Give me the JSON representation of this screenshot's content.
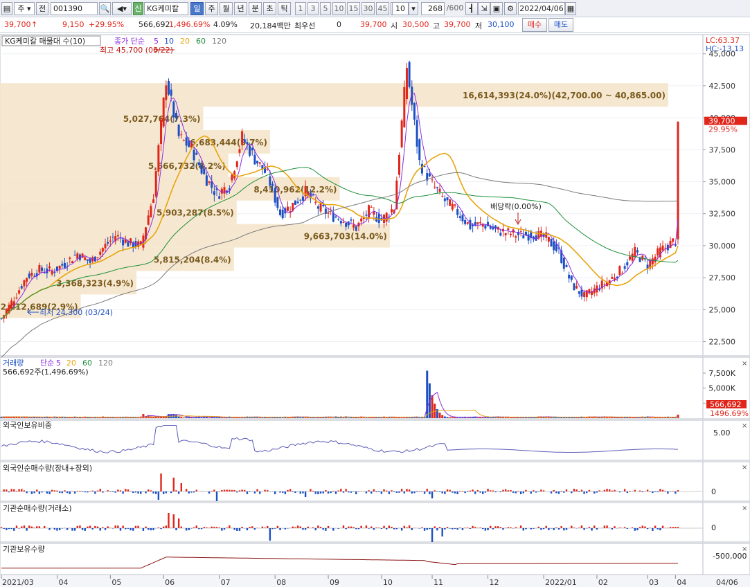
{
  "toolbar": {
    "type_select": "주",
    "prev_label": "전",
    "code": "001390",
    "market_tag": "신",
    "name": "KG케미칼",
    "periods": [
      "일",
      "주",
      "월",
      "년",
      "분",
      "초",
      "틱"
    ],
    "active_period": "일",
    "numbers": [
      "1",
      "3",
      "5",
      "10",
      "15",
      "30",
      "45",
      "60"
    ],
    "count_value": "10",
    "range": "268",
    "range_total": "/600",
    "date": "2022/04/06"
  },
  "quote": {
    "price": "39,700",
    "arrow": "↑",
    "change": "9,150",
    "change_pct": "+29.95%",
    "volume": "566,692",
    "volume_pct": "1,496.69%",
    "turnover": "4.09%",
    "amount": "20,184백만",
    "preferred_label": "최우선",
    "preferred_value": "0",
    "ask": "39,700",
    "open_label": "시",
    "open": "30,500",
    "high_label": "고",
    "high": "39,700",
    "low_label": "저",
    "low": "30,100",
    "buy_label": "매수",
    "sell_label": "매도"
  },
  "colors": {
    "up": "#e0261b",
    "down": "#1d4fc4",
    "ma5": "#8a2be2",
    "ma20": "#e8a40c",
    "ma60": "#1e8f3a",
    "ma120": "#7a7a7a",
    "profile": "#f5e4c8"
  },
  "chart_data": {
    "type": "candlestick",
    "price_panel": {
      "title": "KG케미칼 매물대 수(10)",
      "legend": {
        "label": "종가 단순",
        "periods": [
          "5",
          "10",
          "20",
          "60",
          "120"
        ]
      },
      "y_ticks": [
        "45,000",
        "42,500",
        "40,000",
        "37,500",
        "35,000",
        "32,500",
        "30,000",
        "27,500",
        "25,000",
        "22,500"
      ],
      "ylim": [
        21500,
        46500
      ],
      "lc": "LC:63.37",
      "hc": "HC:-13.13",
      "last_price_tag": "39,700",
      "last_pct_tag": "29.95%",
      "max_annotation": "최고 45,700 (06/22)",
      "min_annotation": "최저 24,300 (03/24)",
      "dividend_annotation": "배당락(0.00%)",
      "volume_profile": [
        {
          "price_from": 40865,
          "price_to": 42700,
          "label": "16,614,393(24.0%)(42,700.00 ~ 40,865.00)",
          "share": 24.0
        },
        {
          "price_from": 39030,
          "price_to": 40865,
          "label": "5,027,764(7.3%)",
          "share": 7.3
        },
        {
          "price_from": 37195,
          "price_to": 39030,
          "label": "6,683,444(9.7%)",
          "share": 9.7
        },
        {
          "price_from": 35360,
          "price_to": 37195,
          "label": "5,666,732(8.2%)",
          "share": 8.2
        },
        {
          "price_from": 33525,
          "price_to": 35360,
          "label": "8,410,962(12.2%)",
          "share": 12.2
        },
        {
          "price_from": 31690,
          "price_to": 33525,
          "label": "5,903,287(8.5%)",
          "share": 8.5
        },
        {
          "price_from": 29855,
          "price_to": 31690,
          "label": "9,663,703(14.0%)",
          "share": 14.0
        },
        {
          "price_from": 28020,
          "price_to": 29855,
          "label": "5,815,204(8.4%)",
          "share": 8.4
        },
        {
          "price_from": 26185,
          "price_to": 28020,
          "label": "3,368,323(4.9%)",
          "share": 4.9
        },
        {
          "price_from": 24350,
          "price_to": 26185,
          "label": "2,012,689(2.9%)",
          "share": 2.9
        }
      ],
      "close_series": [
        {
          "d": "03/24",
          "c": 24300
        },
        {
          "d": "04/01",
          "c": 25900
        },
        {
          "d": "04/09",
          "c": 27600
        },
        {
          "d": "04/16",
          "c": 28100
        },
        {
          "d": "04/23",
          "c": 28000
        },
        {
          "d": "04/30",
          "c": 28600
        },
        {
          "d": "05/07",
          "c": 29400
        },
        {
          "d": "05/14",
          "c": 28700
        },
        {
          "d": "05/21",
          "c": 29800
        },
        {
          "d": "05/28",
          "c": 30800
        },
        {
          "d": "06/04",
          "c": 30200
        },
        {
          "d": "06/11",
          "c": 30000
        },
        {
          "d": "06/16",
          "c": 34000
        },
        {
          "d": "06/22",
          "c": 43000
        },
        {
          "d": "06/29",
          "c": 38500
        },
        {
          "d": "07/06",
          "c": 37600
        },
        {
          "d": "07/13",
          "c": 35500
        },
        {
          "d": "07/20",
          "c": 34000
        },
        {
          "d": "07/27",
          "c": 34800
        },
        {
          "d": "08/03",
          "c": 38500
        },
        {
          "d": "08/10",
          "c": 36800
        },
        {
          "d": "08/17",
          "c": 35500
        },
        {
          "d": "08/24",
          "c": 32500
        },
        {
          "d": "08/31",
          "c": 33200
        },
        {
          "d": "09/07",
          "c": 34200
        },
        {
          "d": "09/14",
          "c": 33000
        },
        {
          "d": "09/24",
          "c": 32400
        },
        {
          "d": "10/01",
          "c": 32000
        },
        {
          "d": "10/08",
          "c": 31400
        },
        {
          "d": "10/15",
          "c": 32700
        },
        {
          "d": "10/22",
          "c": 32000
        },
        {
          "d": "10/29",
          "c": 33000
        },
        {
          "d": "11/01",
          "c": 44000
        },
        {
          "d": "11/05",
          "c": 36500
        },
        {
          "d": "11/12",
          "c": 34800
        },
        {
          "d": "11/19",
          "c": 33500
        },
        {
          "d": "11/26",
          "c": 32600
        },
        {
          "d": "12/03",
          "c": 31500
        },
        {
          "d": "12/10",
          "c": 31700
        },
        {
          "d": "12/17",
          "c": 31200
        },
        {
          "d": "12/24",
          "c": 31000
        },
        {
          "d": "12/31",
          "c": 30800
        },
        {
          "d": "01/07",
          "c": 30900
        },
        {
          "d": "01/14",
          "c": 30600
        },
        {
          "d": "01/21",
          "c": 29500
        },
        {
          "d": "01/28",
          "c": 27000
        },
        {
          "d": "02/04",
          "c": 26000
        },
        {
          "d": "02/11",
          "c": 26700
        },
        {
          "d": "02/18",
          "c": 27300
        },
        {
          "d": "02/25",
          "c": 28200
        },
        {
          "d": "03/04",
          "c": 29500
        },
        {
          "d": "03/11",
          "c": 28500
        },
        {
          "d": "03/18",
          "c": 29600
        },
        {
          "d": "03/25",
          "c": 30300
        },
        {
          "d": "04/01",
          "c": 30600
        },
        {
          "d": "04/06",
          "c": 39700
        }
      ]
    },
    "volume_panel": {
      "title": "거래량",
      "legend": [
        "단순",
        "5",
        "20",
        "60",
        "120"
      ],
      "summary": "566,692주(1,496.69%)",
      "y_ticks": [
        "7,500K",
        "5,000K",
        "2,500K"
      ],
      "last_value_tag": "566,692",
      "last_pct_tag": "1496.69%",
      "spike": {
        "date": "11/01",
        "value": 7900000
      }
    },
    "foreign_ratio_panel": {
      "title": "외국인보유비중",
      "y_ticks": [
        "5.00"
      ]
    },
    "foreign_net_panel": {
      "title": "외국인순매수량(장내+장외)",
      "y_ticks": [
        "0"
      ]
    },
    "inst_net_panel": {
      "title": "기관순매수량(거래소)",
      "y_ticks": [
        "0"
      ]
    },
    "inst_hold_panel": {
      "title": "기관보유수량",
      "y_ticks": [
        "-500,000"
      ]
    },
    "x_ticks": [
      "2021/03",
      "04",
      "05",
      "06",
      "07",
      "08",
      "09",
      "10",
      "11",
      "12",
      "2022/01",
      "02",
      "03",
      "04",
      "04/06"
    ]
  }
}
